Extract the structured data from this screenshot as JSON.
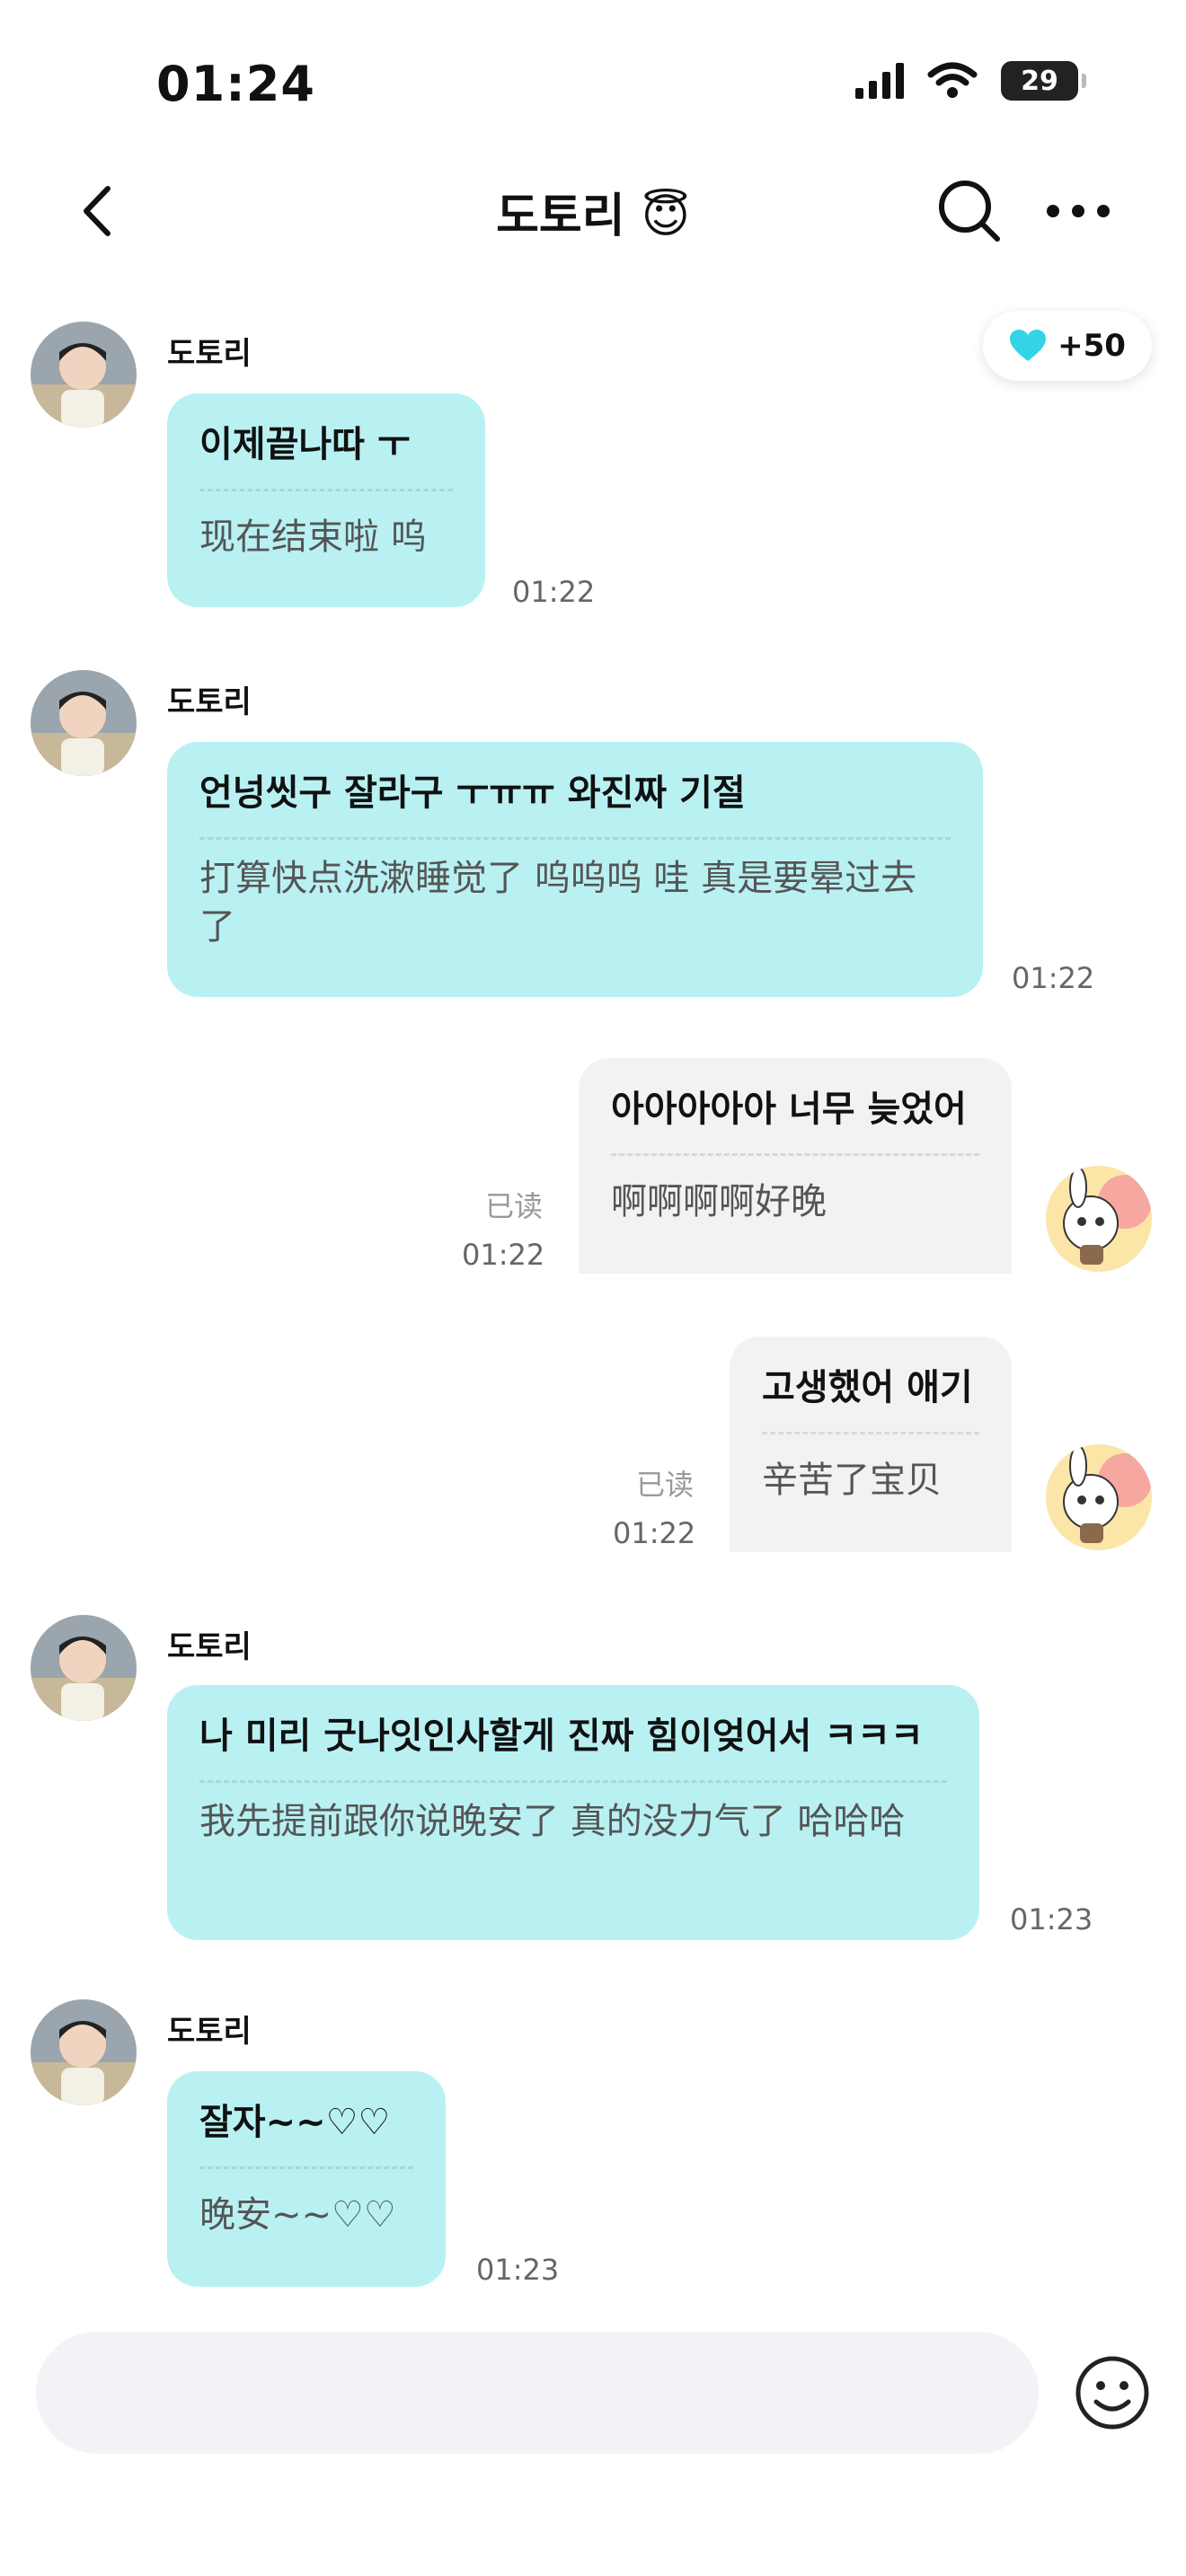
{
  "status_bar": {
    "time": "01:24",
    "battery": "29"
  },
  "header": {
    "title": "도토리 😇"
  },
  "badge": {
    "label": "+50",
    "icon": "heart-icon",
    "color": "#35d3e6"
  },
  "colors": {
    "incoming_bubble": "#b9f1f3",
    "outgoing_bubble": "#f1f2f4"
  },
  "messages": [
    {
      "sender": "도토리",
      "ko": "이제끝나따 ㅜ",
      "zh": "现在结束啦 呜",
      "time": "01:22"
    },
    {
      "sender": "도토리",
      "ko": "언넝씻구 잘라구 ㅜㅠㅠ 와진짜 기절",
      "zh": "打算快点洗漱睡觉了 呜呜呜 哇 真是要晕过去了",
      "time": "01:22"
    },
    {
      "ko": "아아아아아 너무 늦었어",
      "zh": "啊啊啊啊好晚",
      "read": "已读",
      "time": "01:22"
    },
    {
      "ko": "고생했어 애기",
      "zh": "辛苦了宝贝",
      "read": "已读",
      "time": "01:22"
    },
    {
      "sender": "도토리",
      "ko": "나 미리 굿나잇인사할게 진짜 힘이엊어서 ㅋㅋㅋ",
      "zh": "我先提前跟你说晚安了 真的没力气了 哈哈哈",
      "time": "01:23"
    },
    {
      "sender": "도토리",
      "ko": "잘자~~♡♡",
      "zh": "晚安~~♡♡",
      "time": "01:23"
    }
  ],
  "input": {
    "placeholder": ""
  }
}
